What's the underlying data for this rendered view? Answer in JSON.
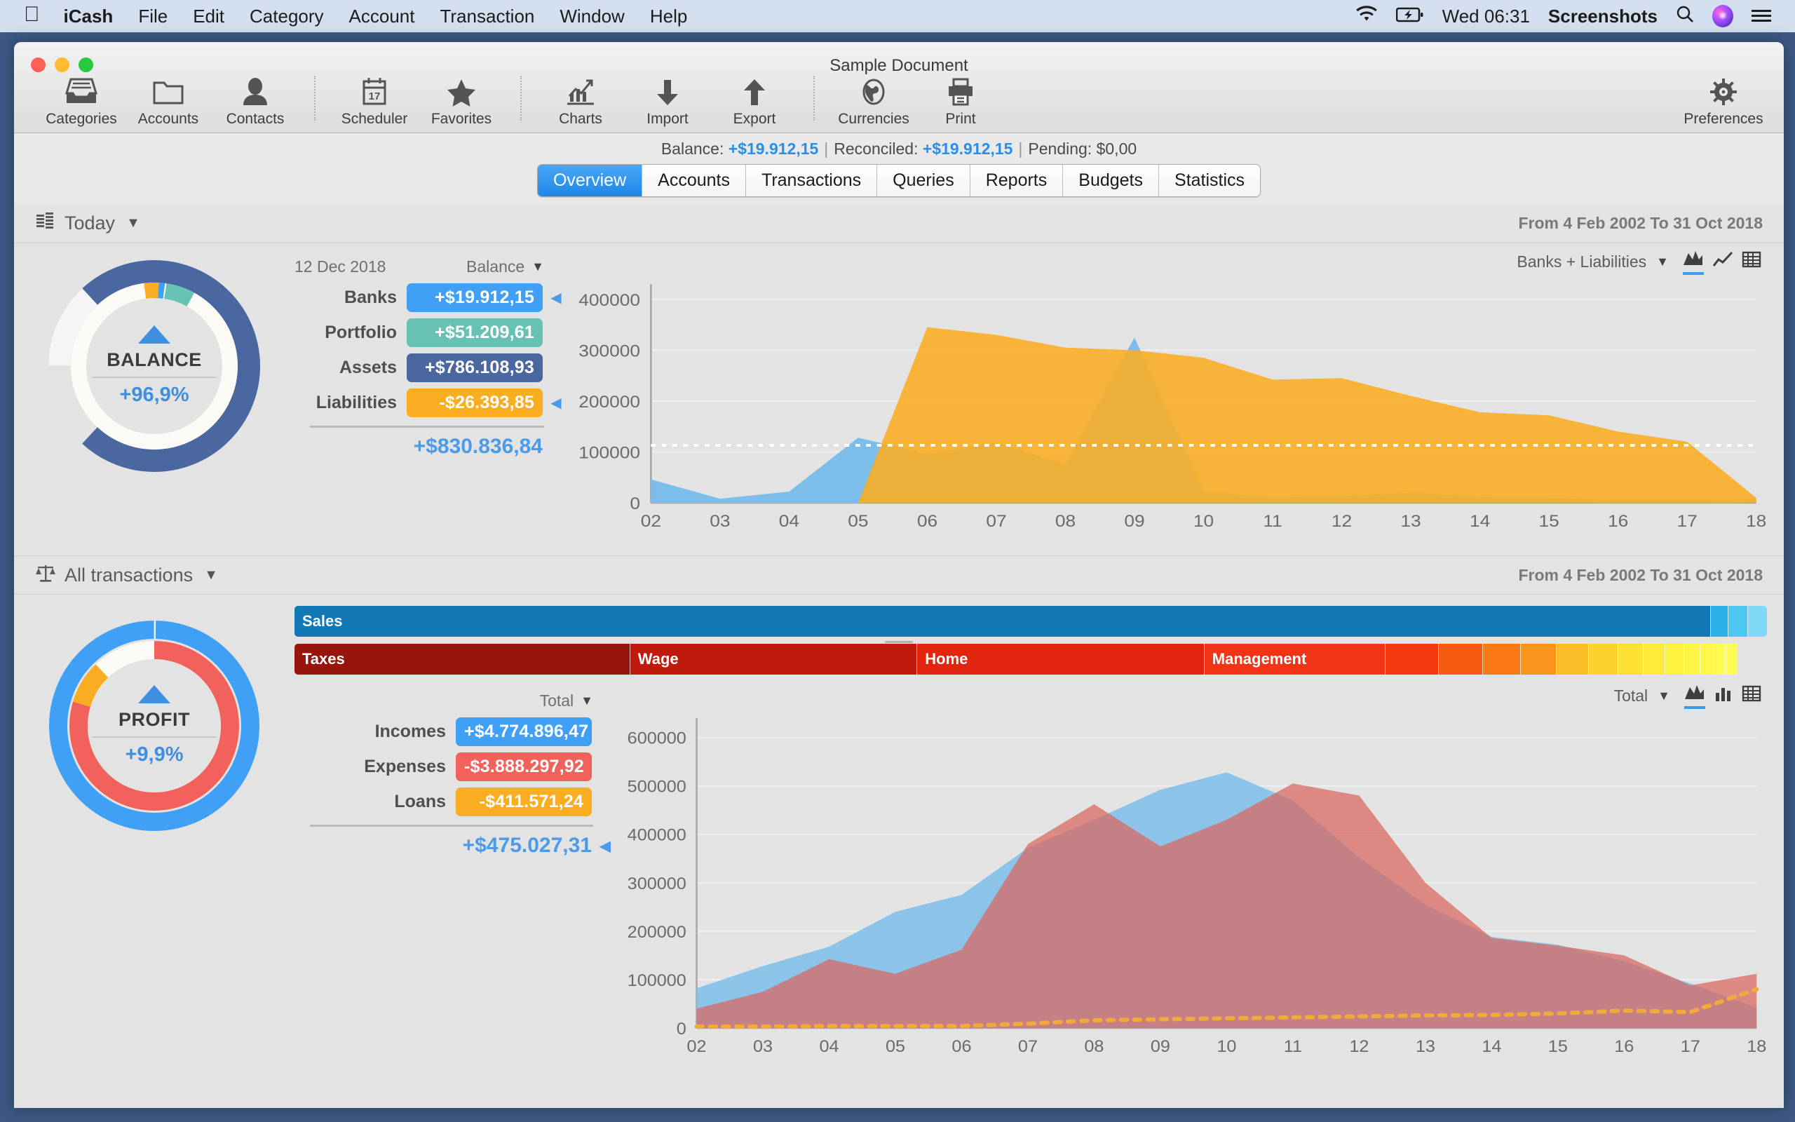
{
  "menubar": {
    "apple_icon": "apple-logo-icon",
    "app_name": "iCash",
    "items": [
      "File",
      "Edit",
      "Category",
      "Account",
      "Transaction",
      "Window",
      "Help"
    ],
    "right": {
      "wifi_icon": "wifi-icon",
      "battery_icon": "battery-charging-icon",
      "clock": "Wed 06:31",
      "app_label": "Screenshots",
      "search_icon": "search-icon",
      "siri_icon": "siri-icon",
      "control_center_icon": "control-center-icon"
    }
  },
  "window": {
    "title": "Sample Document",
    "traffic": {
      "close": "#ff5f57",
      "minimize": "#febc2e",
      "zoom": "#28c840"
    }
  },
  "toolbar": {
    "groups": [
      [
        {
          "label": "Categories",
          "icon": "categories-tray-icon"
        },
        {
          "label": "Accounts",
          "icon": "folder-icon"
        },
        {
          "label": "Contacts",
          "icon": "person-icon"
        }
      ],
      [
        {
          "label": "Scheduler",
          "icon": "calendar-17-icon"
        },
        {
          "label": "Favorites",
          "icon": "star-icon"
        }
      ],
      [
        {
          "label": "Charts",
          "icon": "bar-chart-trend-icon"
        },
        {
          "label": "Import",
          "icon": "arrow-down-icon"
        },
        {
          "label": "Export",
          "icon": "arrow-up-icon"
        }
      ],
      [
        {
          "label": "Currencies",
          "icon": "globe-icon"
        },
        {
          "label": "Print",
          "icon": "printer-icon"
        }
      ]
    ],
    "preferences": {
      "label": "Preferences",
      "icon": "gear-icon"
    }
  },
  "statusline": {
    "balance_label": "Balance:",
    "balance_value": "+$19.912,15",
    "reconciled_label": "Reconciled:",
    "reconciled_value": "+$19.912,15",
    "pending_label": "Pending:",
    "pending_value": "$0,00",
    "separator": "|"
  },
  "tabs": {
    "items": [
      "Overview",
      "Accounts",
      "Transactions",
      "Queries",
      "Reports",
      "Budgets",
      "Statistics"
    ],
    "active": "Overview"
  },
  "today_section": {
    "icon": "stacked-coins-icon",
    "title": "Today",
    "caret": "▼",
    "date_range": "From 4 Feb 2002 To 31 Oct 2018",
    "donut": {
      "center_name": "BALANCE",
      "center_pct": "+96,9%",
      "trend_icon": "triangle-up-icon"
    },
    "table": {
      "date": "12 Dec 2018",
      "column_label": "Balance",
      "caret": "▼",
      "rows": [
        {
          "label": "Banks",
          "value": "+$19.912,15",
          "color": "#3fa0f5",
          "marker": true
        },
        {
          "label": "Portfolio",
          "value": "+$51.209,61",
          "color": "#68c2b4",
          "marker": false
        },
        {
          "label": "Assets",
          "value": "+$786.108,93",
          "color": "#4a689f",
          "marker": false
        },
        {
          "label": "Liabilities",
          "value": "-$26.393,85",
          "color": "#fbad21",
          "marker": true
        }
      ],
      "total": "+$830.836,84",
      "total_marker": false
    },
    "chart_tools": {
      "selector_label": "Banks + Liabilities",
      "caret": "▼",
      "icons": [
        "area-chart-icon",
        "line-chart-icon",
        "table-view-icon"
      ],
      "selected": "area-chart-icon"
    }
  },
  "transactions_section": {
    "icon": "scales-balance-icon",
    "title": "All transactions",
    "caret": "▼",
    "date_range": "From 4 Feb 2002 To 31 Oct 2018",
    "donut": {
      "center_name": "PROFIT",
      "center_pct": "+9,9%",
      "trend_icon": "triangle-up-icon"
    },
    "income_bar": [
      {
        "label": "Sales",
        "width": 96.2,
        "color": "#1178b5"
      },
      {
        "label": "",
        "width": 1.2,
        "color": "#2bb0e8"
      },
      {
        "label": "",
        "width": 1.3,
        "color": "#4cc8f2"
      },
      {
        "label": "",
        "width": 1.3,
        "color": "#7fd9f7"
      }
    ],
    "expense_bar": [
      {
        "label": "Taxes",
        "width": 22.8,
        "color": "#97150c"
      },
      {
        "label": "Wage",
        "width": 19.5,
        "color": "#bf1a0c"
      },
      {
        "label": "Home",
        "width": 19.5,
        "color": "#e2250f"
      },
      {
        "label": "Management",
        "width": 12.3,
        "color": "#f03415"
      },
      {
        "label": "",
        "width": 3.6,
        "color": "#f4390f"
      },
      {
        "label": "",
        "width": 3.0,
        "color": "#f75a10"
      },
      {
        "label": "",
        "width": 2.6,
        "color": "#f97a14"
      },
      {
        "label": "",
        "width": 2.4,
        "color": "#fb941b"
      },
      {
        "label": "",
        "width": 2.2,
        "color": "#fcbe28"
      },
      {
        "label": "",
        "width": 2.0,
        "color": "#fdd22e"
      },
      {
        "label": "",
        "width": 1.7,
        "color": "#fee135"
      },
      {
        "label": "",
        "width": 1.5,
        "color": "#feea3a"
      },
      {
        "label": "",
        "width": 1.3,
        "color": "#fff23f"
      },
      {
        "label": "",
        "width": 1.1,
        "color": "#fff545"
      },
      {
        "label": "",
        "width": 0.9,
        "color": "#fff84a"
      },
      {
        "label": "",
        "width": 0.8,
        "color": "#fffa50"
      },
      {
        "label": "",
        "width": 0.8,
        "color": "#fffc57"
      }
    ],
    "table": {
      "column_label": "Total",
      "caret": "▼",
      "rows": [
        {
          "label": "Incomes",
          "value": "+$4.774.896,47",
          "color": "#3fa0f5",
          "marker": false
        },
        {
          "label": "Expenses",
          "value": "-$3.888.297,92",
          "color": "#f2625c",
          "marker": false
        },
        {
          "label": "Loans",
          "value": "-$411.571,24",
          "color": "#fbad21",
          "marker": false
        }
      ],
      "total": "+$475.027,31",
      "total_marker": true
    },
    "chart_tools": {
      "selector_label": "Total",
      "caret": "▼",
      "icons": [
        "area-chart-icon",
        "bar-chart-icon",
        "table-view-icon"
      ],
      "selected": "area-chart-icon"
    }
  },
  "chart_data": [
    {
      "id": "banks-liabilities-chart",
      "type": "area",
      "title": "Banks + Liabilities",
      "xlabel": "",
      "ylabel": "",
      "x": [
        "02",
        "03",
        "04",
        "05",
        "06",
        "07",
        "08",
        "09",
        "10",
        "11",
        "12",
        "13",
        "14",
        "15",
        "16",
        "17",
        "18"
      ],
      "ylim": [
        0,
        430000
      ],
      "yticks": [
        0,
        100000,
        200000,
        300000,
        400000
      ],
      "grid": true,
      "legend_position": "top-right",
      "annotations": [
        {
          "type": "dashed-threshold-line",
          "value": 113000,
          "color": "#ffffff"
        }
      ],
      "series": [
        {
          "name": "Banks",
          "color": "#7dbdea",
          "values": [
            46000,
            8000,
            22000,
            128000,
            96000,
            118000,
            75000,
            325000,
            23000,
            10000,
            13000,
            20000,
            11000,
            10000,
            5000,
            5000,
            7000
          ]
        },
        {
          "name": "Liabilities",
          "color": "#fbad21",
          "values": [
            0,
            0,
            0,
            0,
            345000,
            330000,
            305000,
            300000,
            285000,
            242000,
            245000,
            210000,
            178000,
            172000,
            140000,
            120000,
            10000
          ]
        }
      ]
    },
    {
      "id": "total-transactions-chart",
      "type": "area",
      "title": "Total",
      "xlabel": "",
      "ylabel": "",
      "x": [
        "02",
        "03",
        "04",
        "05",
        "06",
        "07",
        "08",
        "09",
        "10",
        "11",
        "12",
        "13",
        "14",
        "15",
        "16",
        "17",
        "18"
      ],
      "ylim": [
        0,
        640000
      ],
      "yticks": [
        0,
        100000,
        200000,
        300000,
        400000,
        500000,
        600000
      ],
      "grid": true,
      "legend_position": "top-right",
      "series": [
        {
          "name": "Incomes",
          "color": "#7dbdea",
          "values": [
            82000,
            128000,
            168000,
            240000,
            275000,
            372000,
            430000,
            492000,
            528000,
            470000,
            352000,
            255000,
            188000,
            172000,
            138000,
            92000,
            42000
          ]
        },
        {
          "name": "Expenses",
          "color": "#d9665e",
          "values": [
            40000,
            75000,
            142000,
            112000,
            162000,
            380000,
            462000,
            375000,
            430000,
            505000,
            480000,
            300000,
            186000,
            170000,
            150000,
            88000,
            112000
          ]
        },
        {
          "name": "Loans",
          "color": "#f2a93b",
          "values": [
            3000,
            3000,
            4000,
            4000,
            4000,
            9000,
            16000,
            18000,
            20000,
            22000,
            24000,
            26000,
            27000,
            30000,
            36000,
            33000,
            80000
          ]
        }
      ]
    }
  ]
}
